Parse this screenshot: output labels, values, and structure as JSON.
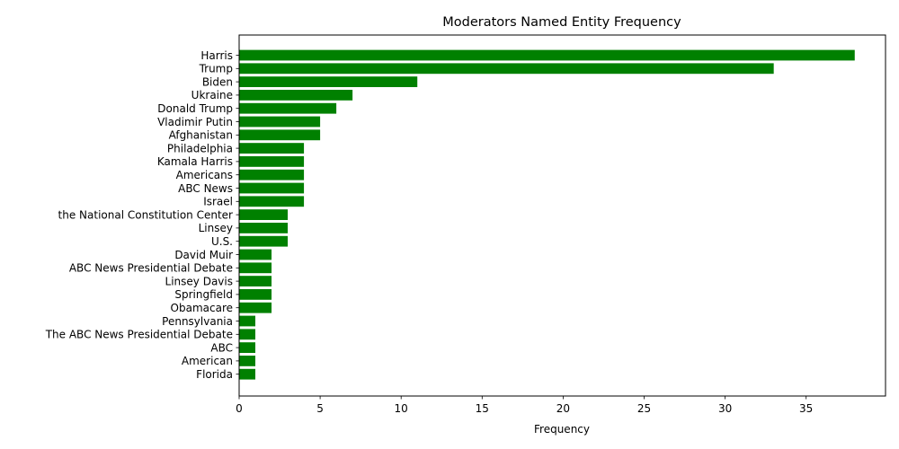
{
  "chart_data": {
    "type": "bar",
    "orientation": "horizontal",
    "title": "Moderators Named Entity Frequency",
    "xlabel": "Frequency",
    "ylabel": "",
    "xlim": [
      0,
      39.9
    ],
    "xticks": [
      0,
      5,
      10,
      15,
      20,
      25,
      30,
      35
    ],
    "grid": false,
    "bar_color": "#008000",
    "categories": [
      "Harris",
      "Trump",
      "Biden",
      "Ukraine",
      "Donald Trump",
      "Vladimir Putin",
      "Afghanistan",
      "Philadelphia",
      "Kamala Harris",
      "Americans",
      "ABC News",
      "Israel",
      "the National Constitution Center",
      "Linsey",
      "U.S.",
      "David Muir",
      "ABC News Presidential Debate",
      "Linsey Davis",
      "Springfield",
      "Obamacare",
      "Pennsylvania",
      "The ABC News Presidential Debate",
      "ABC",
      "American",
      "Florida"
    ],
    "values": [
      38,
      33,
      11,
      7,
      6,
      5,
      5,
      4,
      4,
      4,
      4,
      4,
      3,
      3,
      3,
      2,
      2,
      2,
      2,
      2,
      1,
      1,
      1,
      1,
      1
    ]
  }
}
